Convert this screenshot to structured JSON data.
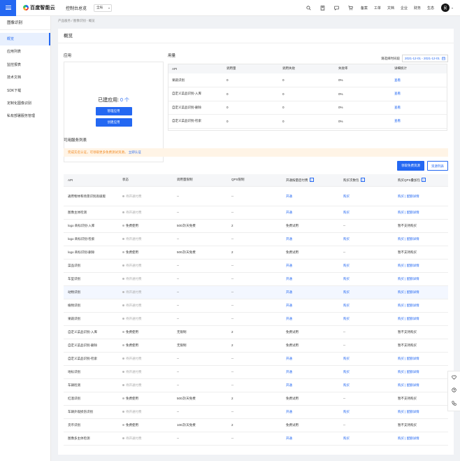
{
  "topnav": {
    "logo_text": "百度智能云",
    "console": "控制台总览",
    "region": "全局",
    "links": [
      "备案",
      "工单",
      "文档",
      "企业",
      "财务",
      "生态"
    ],
    "avatar": "民",
    "icons": [
      "search-icon",
      "calculator-icon",
      "message-icon",
      "cart-icon"
    ]
  },
  "sidebar": {
    "title": "图像识别",
    "items": [
      {
        "label": "概览",
        "active": true
      },
      {
        "label": "应用列表"
      },
      {
        "label": "监控报表"
      },
      {
        "label": "技术文档"
      },
      {
        "label": "SDK下载"
      },
      {
        "label": "定制化图像识别"
      },
      {
        "label": "私有部署服务管理"
      }
    ]
  },
  "breadcrumb": "产品服务 / 图像识别 - 概览",
  "page_title": "概览",
  "apps": {
    "label": "应用",
    "created_text": "已建应用:",
    "count": "0 个",
    "manage_button": "管理应用",
    "create_button": "创建应用"
  },
  "usage": {
    "label": "用量",
    "time_label": "请选择时间段",
    "date_range": "2021-12-01 - 2021-12-01",
    "headers": [
      "API",
      "调用量",
      "调用失败",
      "失败率",
      "详细统计"
    ],
    "rows": [
      [
        "果蔬识别",
        "0",
        "0",
        "0%",
        "查看"
      ],
      [
        "自定义菜品识别-入库",
        "0",
        "0",
        "0%",
        "查看"
      ],
      [
        "自定义菜品识别-删除",
        "0",
        "0",
        "0%",
        "查看"
      ],
      [
        "自定义菜品识别-检索",
        "0",
        "0",
        "0%",
        "查看"
      ]
    ]
  },
  "services": {
    "label": "可用服务列表",
    "notice_text": "完成实名认证，可领取更多免费测试资源。",
    "notice_link": "立即认证",
    "claim_button": "领取免费资源",
    "pay_button": "资源列表",
    "headers": [
      "API",
      "状态",
      "调用量限制",
      "QPS限制",
      "开通按量后付费",
      "购买次数包",
      "购买QPS叠加包"
    ],
    "rows": [
      [
        "通用物体和场景识别高级版",
        "待开通付费",
        "--",
        "--",
        "开通",
        "购买",
        "购买 | 配额详情"
      ],
      [
        "图像主体检测",
        "待开通付费",
        "--",
        "--",
        "开通",
        "购买",
        "购买 | 配额详情"
      ],
      [
        "logo 商标识别-入库",
        "免费使用",
        "500次/天免费",
        "2",
        "免费试用",
        "--",
        "暂不支持购买"
      ],
      [
        "logo 商标识别-检索",
        "待开通付费",
        "--",
        "--",
        "开通",
        "购买",
        "购买 | 配额详情"
      ],
      [
        "logo 商标识别-删除",
        "免费使用",
        "500次/天免费",
        "2",
        "免费试用",
        "--",
        "暂不支持购买"
      ],
      [
        "菜品识别",
        "待开通付费",
        "--",
        "--",
        "开通",
        "购买",
        "购买 | 配额详情"
      ],
      [
        "车型识别",
        "待开通付费",
        "--",
        "--",
        "开通",
        "购买",
        "购买 | 配额详情"
      ],
      [
        "动物识别",
        "待开通付费",
        "--",
        "--",
        "开通",
        "购买",
        "购买 | 配额详情"
      ],
      [
        "植物识别",
        "待开通付费",
        "--",
        "--",
        "开通",
        "购买",
        "购买 | 配额详情"
      ],
      [
        "果蔬识别",
        "待开通付费",
        "--",
        "--",
        "开通",
        "购买",
        "购买 | 配额详情"
      ],
      [
        "自定义菜品识别-入库",
        "免费使用",
        "无限制",
        "2",
        "免费试用",
        "--",
        "暂不支持购买"
      ],
      [
        "自定义菜品识别-删除",
        "免费使用",
        "无限制",
        "2",
        "免费试用",
        "--",
        "暂不支持购买"
      ],
      [
        "自定义菜品识别-检索",
        "待开通付费",
        "--",
        "--",
        "开通",
        "购买",
        "购买 | 配额详情"
      ],
      [
        "地标识别",
        "待开通付费",
        "--",
        "--",
        "开通",
        "购买",
        "购买 | 配额详情"
      ],
      [
        "车辆检测",
        "待开通付费",
        "--",
        "--",
        "开通",
        "购买",
        "购买 | 配额详情"
      ],
      [
        "红酒识别",
        "免费使用",
        "500次/天免费",
        "2",
        "免费试用",
        "--",
        "暂不支持购买"
      ],
      [
        "车辆外观损伤识别",
        "待开通付费",
        "--",
        "--",
        "开通",
        "购买",
        "购买 | 配额详情"
      ],
      [
        "货币识别",
        "免费使用",
        "100次/天免费",
        "2",
        "免费试用",
        "--",
        "暂不支持购买"
      ],
      [
        "图像多主体检测",
        "待开通付费",
        "--",
        "--",
        "开通",
        "购买",
        "购买 | 配额详情"
      ]
    ]
  },
  "colors": {
    "primary": "#2468f2",
    "notice": "#f08a24"
  }
}
